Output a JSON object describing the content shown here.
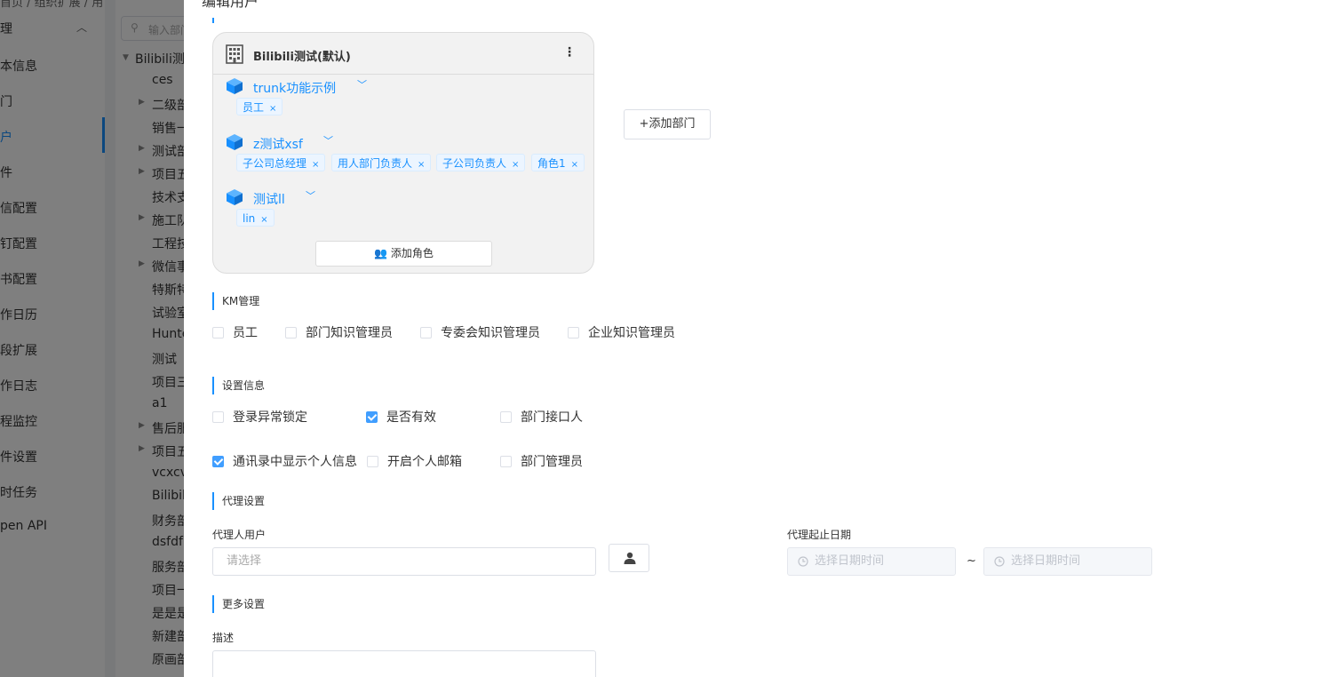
{
  "background": {
    "breadcrumb": "首页 / 组织扩展 / 用",
    "nav_section": "理",
    "nav_items": [
      "本信息",
      "门",
      "户",
      "件",
      "信配置",
      "钉配置",
      "书配置",
      "作日历",
      "段扩展",
      "作日志",
      "程监控",
      "件设置",
      "时任务",
      "pen API"
    ],
    "tree_search_placeholder": "输入部门",
    "tree_nodes": [
      "Bilibili测",
      "ces",
      "二级部",
      "销售一",
      "测试部",
      "项目五",
      "技术支",
      "施工队",
      "工程技",
      "微信事",
      "特斯特",
      "试验室",
      "Hunte",
      "测试",
      "项目三",
      "a1",
      "售后服",
      "项目五",
      "vcxcv",
      "Bilibil",
      "财务部",
      "dsfdf",
      "服务部",
      "项目一",
      "是是是",
      "新建部",
      "原画部"
    ]
  },
  "drawer": {
    "title": "编辑用户",
    "org_card": {
      "company_name": "Bilibili测试(默认)",
      "departments": [
        {
          "name": "trunk功能示例",
          "roles": [
            "员工"
          ]
        },
        {
          "name": "z测试xsf",
          "roles": [
            "子公司总经理",
            "用人部门负责人",
            "子公司负责人",
            "角色1"
          ]
        },
        {
          "name": "测试ll",
          "roles": [
            "lin"
          ]
        }
      ],
      "add_role_label": "添加角色"
    },
    "add_dept_label": "+添加部门",
    "km": {
      "title": "KM管理",
      "options": [
        {
          "label": "员工",
          "checked": false
        },
        {
          "label": "部门知识管理员",
          "checked": false
        },
        {
          "label": "专委会知识管理员",
          "checked": false
        },
        {
          "label": "企业知识管理员",
          "checked": false
        }
      ]
    },
    "settings": {
      "title": "设置信息",
      "options": [
        {
          "label": "登录异常锁定",
          "checked": false
        },
        {
          "label": "是否有效",
          "checked": true
        },
        {
          "label": "部门接口人",
          "checked": false
        },
        {
          "label": "通讯录中显示个人信息",
          "checked": true
        },
        {
          "label": "开启个人邮箱",
          "checked": false
        },
        {
          "label": "部门管理员",
          "checked": false
        }
      ]
    },
    "proxy": {
      "title": "代理设置",
      "user_label": "代理人用户",
      "user_placeholder": "请选择",
      "date_label": "代理起止日期",
      "start_placeholder": "选择日期时间",
      "end_placeholder": "选择日期时间",
      "separator": "~"
    },
    "more": {
      "title": "更多设置",
      "desc_label": "描述"
    }
  }
}
